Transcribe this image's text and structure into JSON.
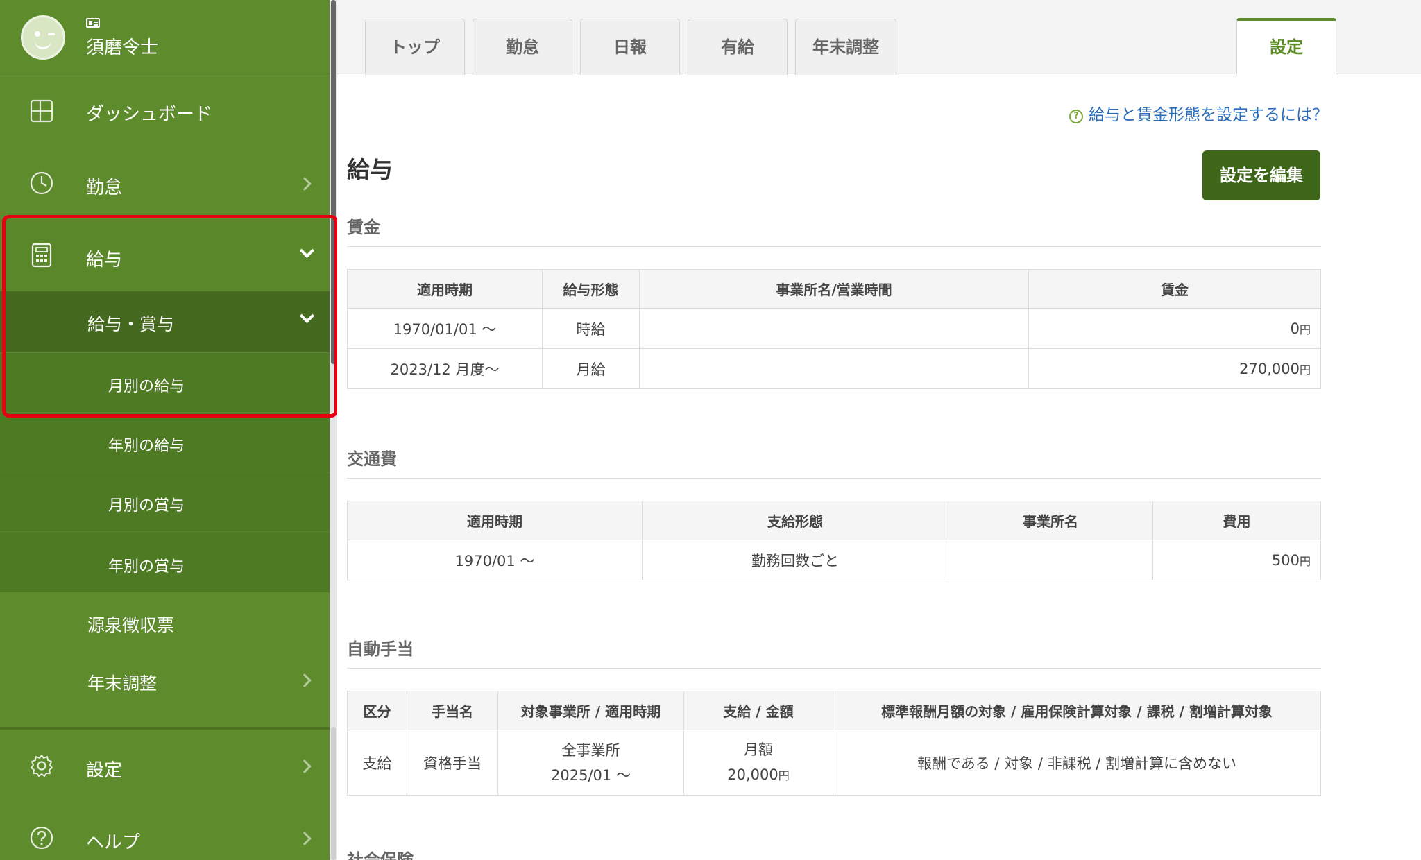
{
  "user": {
    "name": "須磨令士"
  },
  "sidebar": {
    "dashboard": "ダッシュボード",
    "attendance": "勤怠",
    "payroll": "給与",
    "payroll_bonus": "給与・賞与",
    "monthly_salary": "月別の給与",
    "yearly_salary": "年別の給与",
    "monthly_bonus": "月別の賞与",
    "yearly_bonus": "年別の賞与",
    "withholding": "源泉徴収票",
    "year_end": "年末調整",
    "settings": "設定",
    "help": "ヘルプ"
  },
  "tabs": [
    "トップ",
    "勤怠",
    "日報",
    "有給",
    "年末調整",
    "設定"
  ],
  "active_tab": "設定",
  "help_link": "給与と賃金形態を設定するには？",
  "page_title": "給与",
  "edit_button": "設定を編集",
  "wage": {
    "heading": "賃金",
    "headers": [
      "適用時期",
      "給与形態",
      "事業所名/営業時間",
      "賃金"
    ],
    "rows": [
      {
        "period": "1970/01/01 〜",
        "type": "時給",
        "office": "",
        "amount": "0",
        "unit": "円"
      },
      {
        "period": "2023/12 月度〜",
        "type": "月給",
        "office": "",
        "amount": "270,000",
        "unit": "円"
      }
    ]
  },
  "transport": {
    "heading": "交通費",
    "headers": [
      "適用時期",
      "支給形態",
      "事業所名",
      "費用"
    ],
    "rows": [
      {
        "period": "1970/01 〜",
        "type": "勤務回数ごと",
        "office": "",
        "amount": "500",
        "unit": "円"
      }
    ]
  },
  "allowance": {
    "heading": "自動手当",
    "headers": [
      "区分",
      "手当名",
      "対象事業所 / 適用時期",
      "支給 / 金額",
      "標準報酬月額の対象 / 雇用保険計算対象 / 課税 / 割増計算対象"
    ],
    "rows": [
      {
        "kind": "支給",
        "name": "資格手当",
        "office": "全事業所",
        "period": "2025/01 〜",
        "pay_type": "月額",
        "amount": "20,000",
        "unit": "円",
        "flags": "報酬である / 対象 / 非課税 / 割増計算に含めない"
      }
    ]
  },
  "next_section": "社会保険",
  "colors": {
    "sidebar": "#5e8c2d",
    "sidebar_sub": "#4b7422",
    "accent": "#3d6618",
    "link": "#2a6ebb",
    "highlight": "#e60012"
  }
}
